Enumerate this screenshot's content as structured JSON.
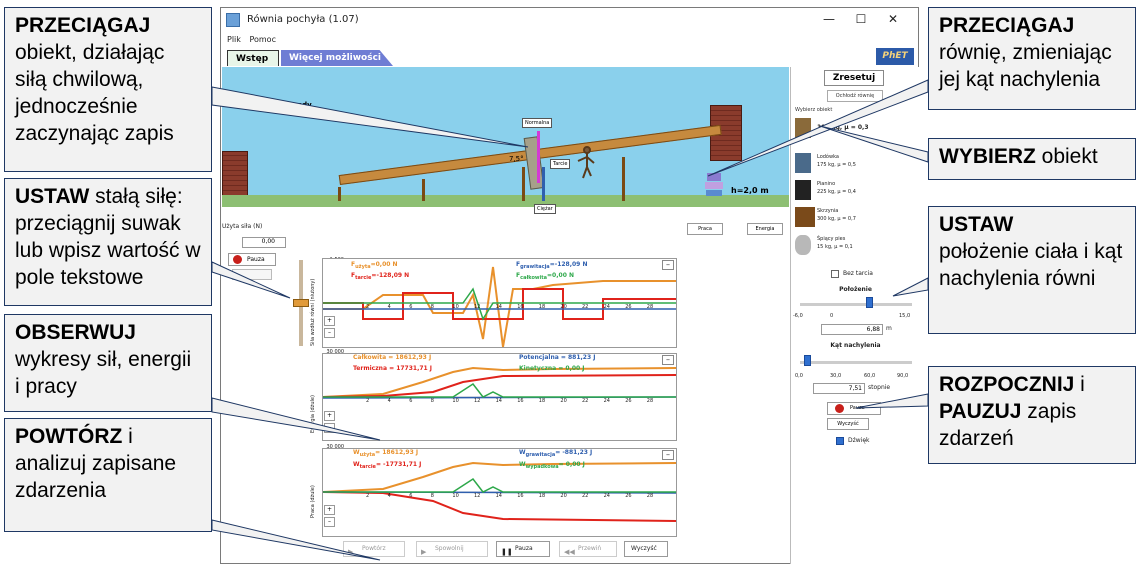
{
  "window": {
    "title": "Równia pochyła (1.07)",
    "min": "—",
    "max": "☐",
    "close": "✕"
  },
  "menu": [
    "Plik",
    "Pomoc"
  ],
  "tabs": [
    "Wstęp",
    "Więcej możliwości"
  ],
  "phet_logo": "PhET",
  "scene": {
    "timer": "30,00 sekundy",
    "force_labels": {
      "normal": "Normalna",
      "friction": "Tarcie",
      "weight": "Ciężar"
    },
    "angle": "7,5°",
    "height": "h=2,0 m",
    "work_btn": "Praca",
    "energy_btn": "Energia"
  },
  "force_control": {
    "label": "Użyta siła (N)",
    "value": "0,00",
    "pause": "Pauza",
    "grey": ""
  },
  "graph1": {
    "ylabel": "Siła wzdłuż równi (niutony)",
    "yticks": [
      "1 500",
      "1 000",
      "500",
      "0",
      "-500",
      "-1 000",
      "-1 500"
    ],
    "applied_label": "F",
    "applied_sub": "użyta",
    "applied_value": "=0,00 N",
    "friction_label": "F",
    "friction_sub": "tarcie",
    "friction_value": "=-128,09 N",
    "gravity_label": "F",
    "gravity_sub": "grawitacja",
    "gravity_value": "=-128,09 N",
    "total_label": "F",
    "total_sub": "całkowita",
    "total_value": "=0,00 N"
  },
  "graph2": {
    "ylabel": "Energia (dżule)",
    "yticks": [
      "30 000",
      "20 000",
      "10 000",
      "0",
      "-10 000",
      "-20 000",
      "-30 000"
    ],
    "total": "Całkowita = 18612,93 J",
    "potential": "Potencjalna = 881,23 J",
    "thermal": "Termiczna = 17731,71 J",
    "kinetic": "Kinetyczna = 0,00 J"
  },
  "graph3": {
    "ylabel": "Praca (dżule)",
    "yticks": [
      "30 000",
      "20 000",
      "10 000",
      "0",
      "-10 000",
      "-20 000",
      "-30 000"
    ],
    "applied_label": "W",
    "applied_sub": "użyta",
    "applied_value": "= 18612,93 J",
    "gravity_label": "W",
    "gravity_sub": "grawitacja",
    "gravity_value": "= -881,23 J",
    "friction_label": "W",
    "friction_sub": "tarcie",
    "friction_value": "= -17731,71 J",
    "fall_label": "W",
    "fall_sub": "wypadkowa",
    "fall_value": "= 0,00 J"
  },
  "xticks": [
    "2",
    "4",
    "6",
    "8",
    "10",
    "12",
    "14",
    "16",
    "18",
    "20",
    "22",
    "24",
    "26",
    "28"
  ],
  "playback": [
    "Powtórz",
    "Spowolnij",
    "Pauza",
    "Przewiń",
    "Wyczyść"
  ],
  "right_panel": {
    "reset": "Zresetuj",
    "cool": "Ochłodź równię",
    "select_title": "Wybierz obiekt",
    "objects": [
      {
        "name": "Skrzynia",
        "spec": "100 kg, μ = 0,3"
      },
      {
        "name": "Lodówka",
        "spec": "175 kg, μ = 0,5"
      },
      {
        "name": "Pianino",
        "spec": "225 kg, μ = 0,4"
      },
      {
        "name": "Skrzynia",
        "spec": "300 kg, μ = 0,7"
      },
      {
        "name": "Śpiący pies",
        "spec": "15 kg, μ = 0,1"
      }
    ],
    "frictionless": "Bez tarcia",
    "position_label": "Położenie",
    "position_ticks": [
      "-6,0",
      "0",
      "15,0"
    ],
    "position_value": "6,88",
    "position_unit": "m",
    "angle_label": "Kąt nachylenia",
    "angle_ticks": [
      "0,0",
      "30,0",
      "60,0",
      "90,0"
    ],
    "angle_value": "7,51",
    "angle_unit": "stopnie",
    "pause": "Pauza",
    "clear": "Wyczyść",
    "sound": "Dźwięk"
  },
  "callouts": {
    "drag_obj_bold": "PRZECIĄGAJ",
    "drag_obj_text": "obiekt, działając siłą chwilową, jednocześnie zaczynając zapis",
    "set_bold": "USTAW",
    "set_text": " stałą siłę: przeciągnij suwak lub wpisz wartość w pole tekstowe",
    "observe_bold": "OBSERWUJ",
    "observe_text": "wykresy sił, energii i pracy",
    "replay_bold": "POWTÓRZ",
    "replay_text": " i analizuj zapisane zdarzenia",
    "drag_ramp_bold": "PRZECIĄGAJ",
    "drag_ramp_text": "równię, zmieniając jej kąt nachylenia",
    "choose_bold": "WYBIERZ",
    "choose_text": " obiekt",
    "set2_bold": "USTAW",
    "set2_text": "położenie ciała i kąt nachylenia równi",
    "start_bold": "ROZPOCZNIJ",
    "start_mid": " i",
    "pause_bold": "PAUZUJ",
    "pause_text": " zapis zdarzeń"
  },
  "colors": {
    "sky": "#8ad0ec",
    "ground": "#8dbf73",
    "applied": "#e8912c",
    "friction": "#e0231b",
    "gravity": "#2f5fae",
    "total": "#2ea84a",
    "border": "#1f3864"
  }
}
